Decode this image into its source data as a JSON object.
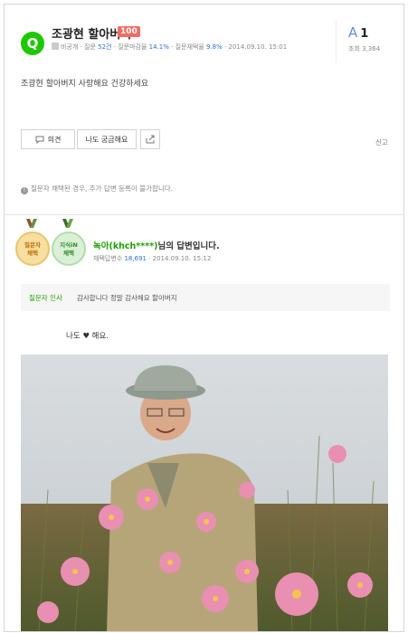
{
  "question": {
    "badge": "Q",
    "title": "조광현 할아버지",
    "points": "100",
    "meta": {
      "visibility": "비공개",
      "questions_label": "질문",
      "questions_count": "52건",
      "deadline_label": "질문마감율",
      "deadline_rate": "14.1%",
      "adopt_label": "질문채택율",
      "adopt_rate": "9.8%",
      "date": "2014.09.10. 15:01"
    },
    "answer_count_label": "A",
    "answer_count": "1",
    "views_label": "조회",
    "views": "3,364",
    "body": "조광현 할아버지 사랑해요 건강하세요",
    "buttons": {
      "opinion": "의견",
      "curious": "나도 궁금해요"
    },
    "report": "신고",
    "notice": "질문자 채택된 경우, 추가 답변 등록이 불가합니다."
  },
  "answer": {
    "medal_a_line1": "질문자",
    "medal_a_line2": "채택",
    "medal_b_line1": "지식iN",
    "medal_b_line2": "채택",
    "author": "녹아(khch****)",
    "author_suffix": "님의 답변입니다.",
    "adopted_label": "채택답변수",
    "adopted_count": "18,691",
    "date": "2014.09.10. 15:12",
    "thanks_label": "질문자 인사",
    "thanks_text": "감사합니다 정말 감사해요 할아버지",
    "text": "나도 ♥ 해요."
  },
  "colors": {
    "green": "#1ec800",
    "blue": "#2e6ed0",
    "badge": "#f36c60"
  }
}
